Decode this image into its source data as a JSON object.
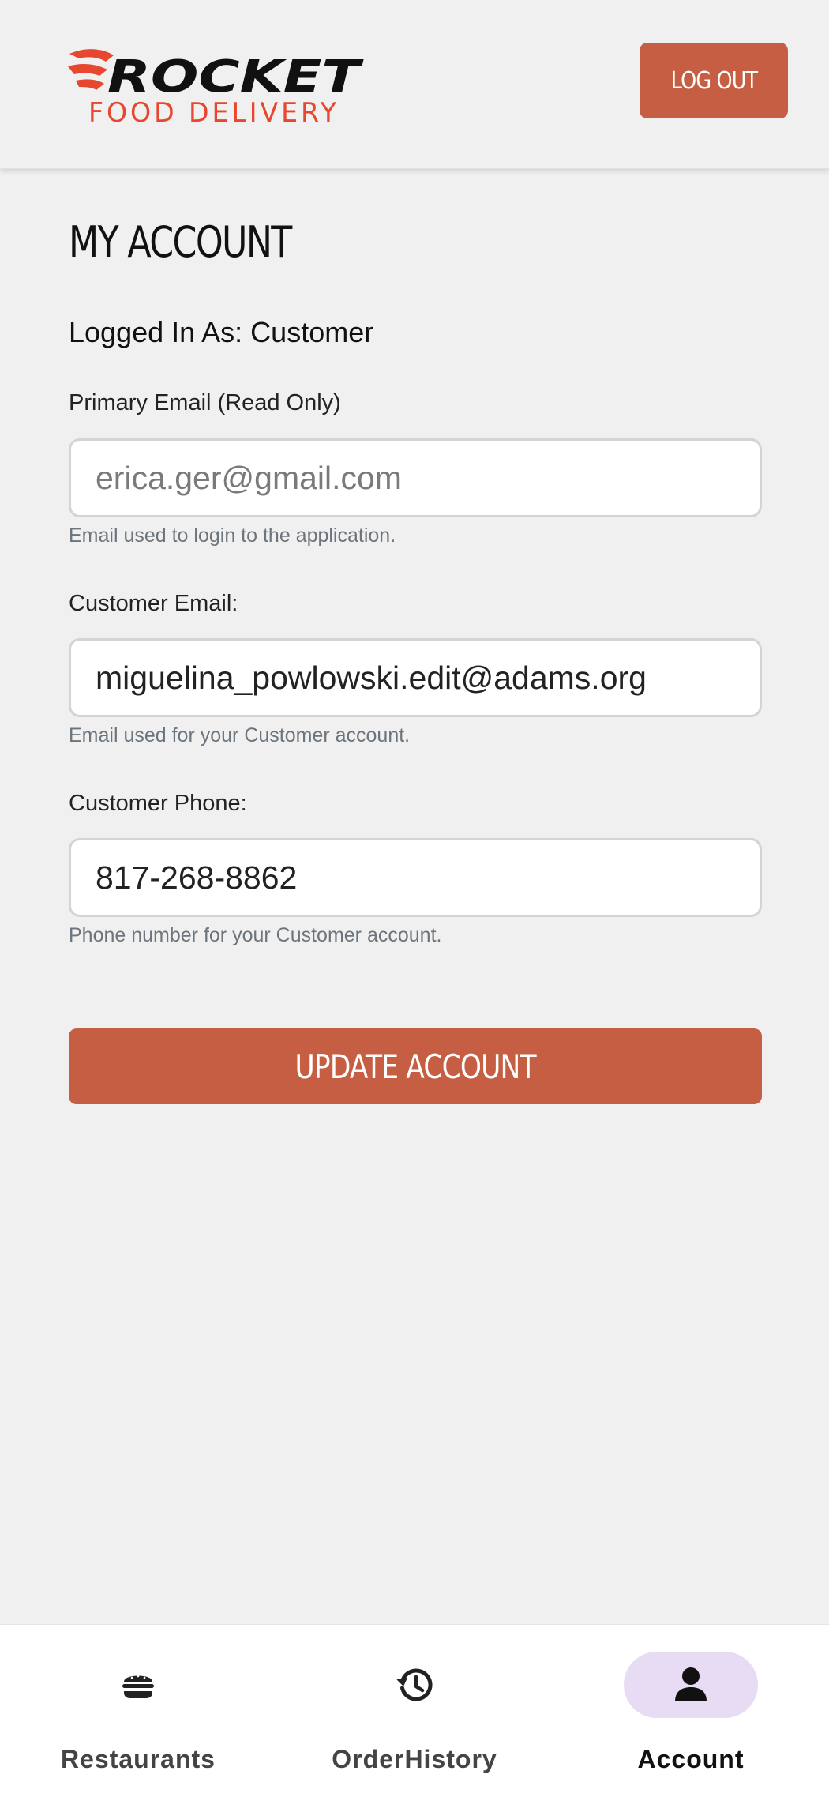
{
  "header": {
    "logo_text": "ROCKET",
    "logo_subtext": "FOOD DELIVERY",
    "logout_label": "LOG OUT"
  },
  "page": {
    "title": "MY ACCOUNT",
    "logged_in_as": "Logged In As: Customer"
  },
  "fields": {
    "primary_email": {
      "label": "Primary Email (Read Only)",
      "value": "erica.ger@gmail.com",
      "help": "Email used to login to the application."
    },
    "customer_email": {
      "label": "Customer Email:",
      "value": "miguelina_powlowski.edit@adams.org",
      "help": "Email used for your Customer account."
    },
    "customer_phone": {
      "label": "Customer Phone:",
      "value": "817-268-8862",
      "help": "Phone number for your Customer account."
    }
  },
  "update_label": "UPDATE ACCOUNT",
  "nav": {
    "items": [
      {
        "label": "Restaurants",
        "icon": "hamburger-icon"
      },
      {
        "label": "OrderHistory",
        "icon": "history-icon"
      },
      {
        "label": "Account",
        "icon": "person-icon",
        "active": true
      }
    ]
  },
  "colors": {
    "accent": "#c55e42",
    "logo_red": "#e8472f",
    "active_pill": "#e8dcf5",
    "background": "#f0f0f0"
  }
}
